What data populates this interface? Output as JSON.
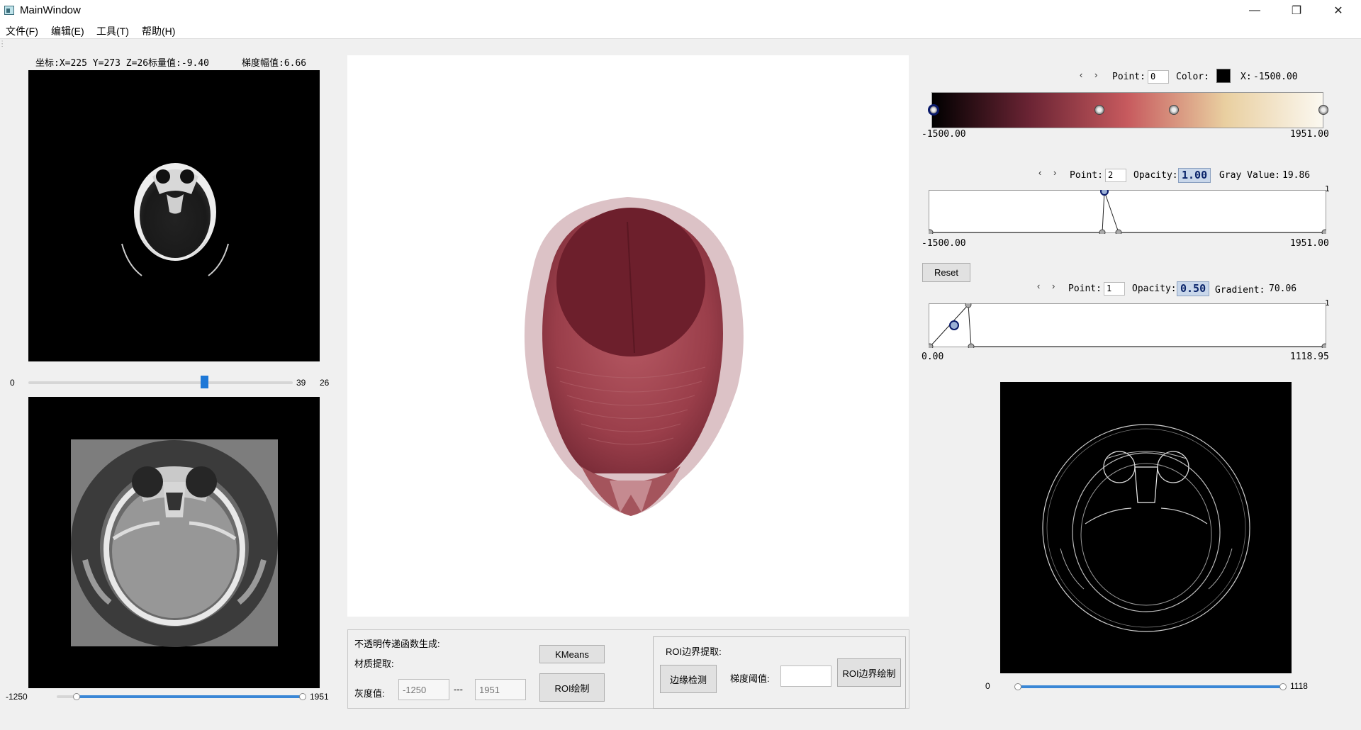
{
  "window": {
    "title": "MainWindow",
    "controls": {
      "minimize": "—",
      "maximize": "❐",
      "close": "✕"
    }
  },
  "menu": [
    "文件(F)",
    "编辑(E)",
    "工具(T)",
    "帮助(H)"
  ],
  "left": {
    "coord_text": "坐标:X=225 Y=273 Z=26标量值:-9.40",
    "gradient_text": "梯度幅值:6.66",
    "slice_slider": {
      "min": "0",
      "max": "39",
      "value": "26",
      "fraction": 0.667
    },
    "window_slider": {
      "min": "-1250",
      "max": "1951",
      "low_fraction": 0.08,
      "high_fraction": 1.0
    }
  },
  "bottom_panel": {
    "opacity_tf_label": "不透明传递函数生成:",
    "material_label": "材质提取:",
    "gray_label": "灰度值:",
    "gray_min_placeholder": "-1250",
    "gray_sep": "---",
    "gray_max_placeholder": "1951",
    "kmeans_button": "KMeans",
    "roi_draw_button": "ROI绘制",
    "roi_boundary_label": "ROI边界提取:",
    "edge_detect_button": "边缘检测",
    "gradient_threshold_label": "梯度阈值:",
    "roi_boundary_draw_button": "ROI边界绘制"
  },
  "color_tf": {
    "prev": "‹",
    "next": "›",
    "point_label": "Point:",
    "point_value": "0",
    "color_label": "Color:",
    "color_value": "#000000",
    "x_label": "X:",
    "x_value": "-1500.00",
    "range_min": "-1500.00",
    "range_max": "1951.00",
    "gradient_stops": [
      "#000000",
      "#6b2434",
      "#c75a5e",
      "#e9cfa0",
      "#fbf8f0"
    ]
  },
  "opacity_tf": {
    "prev": "‹",
    "next": "›",
    "point_label": "Point:",
    "point_value": "2",
    "opacity_label": "Opacity:",
    "opacity_value": "1.00",
    "gray_label": "Gray Value:",
    "gray_value": "19.86",
    "y_max": "1",
    "range_min": "-1500.00",
    "range_max": "1951.00"
  },
  "reset_button": "Reset",
  "gradient_tf": {
    "prev": "‹",
    "next": "›",
    "point_label": "Point:",
    "point_value": "1",
    "opacity_label": "Opacity:",
    "opacity_value": "0.50",
    "gradient_label": "Gradient:",
    "gradient_value": "70.06",
    "y_max": "1",
    "range_min": "0.00",
    "range_max": "1118.95"
  },
  "edge_slider": {
    "min": "0",
    "max": "1118",
    "low_fraction": 0.0,
    "high_fraction": 1.0
  }
}
